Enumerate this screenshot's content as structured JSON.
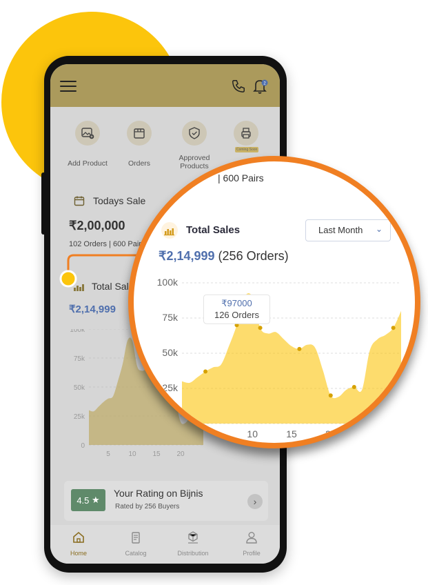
{
  "header": {
    "menu_icon": "menu-icon",
    "call_icon": "phone-icon",
    "notification_icon": "bell-icon",
    "notification_count": "2"
  },
  "quick_actions": [
    {
      "label": "Add Product",
      "icon": "image-add-icon"
    },
    {
      "label": "Orders",
      "icon": "box-icon"
    },
    {
      "label": "Approved Products",
      "icon": "shield-check-icon"
    },
    {
      "label": "",
      "icon": "printer-icon",
      "badge": "Coming Soon"
    }
  ],
  "todays_sale": {
    "title": "Todays Sale",
    "value": "₹2,00,000",
    "subtitle": "102 Orders | 600 Pairs"
  },
  "total_sales": {
    "title": "Total Sales",
    "value": "₹2,14,999",
    "orders": "(256 Orders)",
    "period": "Last Month"
  },
  "tooltip": {
    "value": "₹97000",
    "orders": "126 Orders"
  },
  "chart_data": {
    "type": "area",
    "x": [
      1,
      2,
      3,
      4,
      5,
      6,
      7,
      8,
      9,
      10,
      11,
      12,
      13,
      14,
      15,
      16,
      17,
      18,
      19,
      20,
      21,
      22,
      23,
      24,
      25,
      26,
      27,
      28,
      29
    ],
    "values": [
      30,
      29,
      33,
      37,
      40,
      42,
      55,
      70,
      90,
      90,
      68,
      64,
      65,
      60,
      55,
      53,
      56,
      54,
      38,
      20,
      19,
      24,
      26,
      24,
      52,
      60,
      63,
      68,
      80
    ],
    "ylim": [
      0,
      100
    ],
    "yticks": [
      "0",
      "25k",
      "50k",
      "75k",
      "100k"
    ],
    "xticks": [
      "5",
      "10",
      "15",
      "20"
    ],
    "series_color": "#fcc50c",
    "highlight_x": 8,
    "marker_x": [
      4,
      8,
      11,
      16,
      20,
      23,
      28
    ]
  },
  "rating": {
    "score": "4.5",
    "title": "Your Rating on Bijnis",
    "subtitle": "Rated by 256 Buyers"
  },
  "bottom_nav": [
    {
      "label": "Home",
      "icon": "home-icon",
      "active": true
    },
    {
      "label": "Catalog",
      "icon": "catalog-icon",
      "active": false
    },
    {
      "label": "Distribution",
      "icon": "distribution-icon",
      "active": false
    },
    {
      "label": "Profile",
      "icon": "profile-icon",
      "active": false
    }
  ],
  "zoom": {
    "top_text": "| 600 Pairs"
  },
  "colors": {
    "accent": "#fcc50c",
    "ring": "#f07f22",
    "brand": "#ab9a5c",
    "blue": "#4f6fad"
  }
}
